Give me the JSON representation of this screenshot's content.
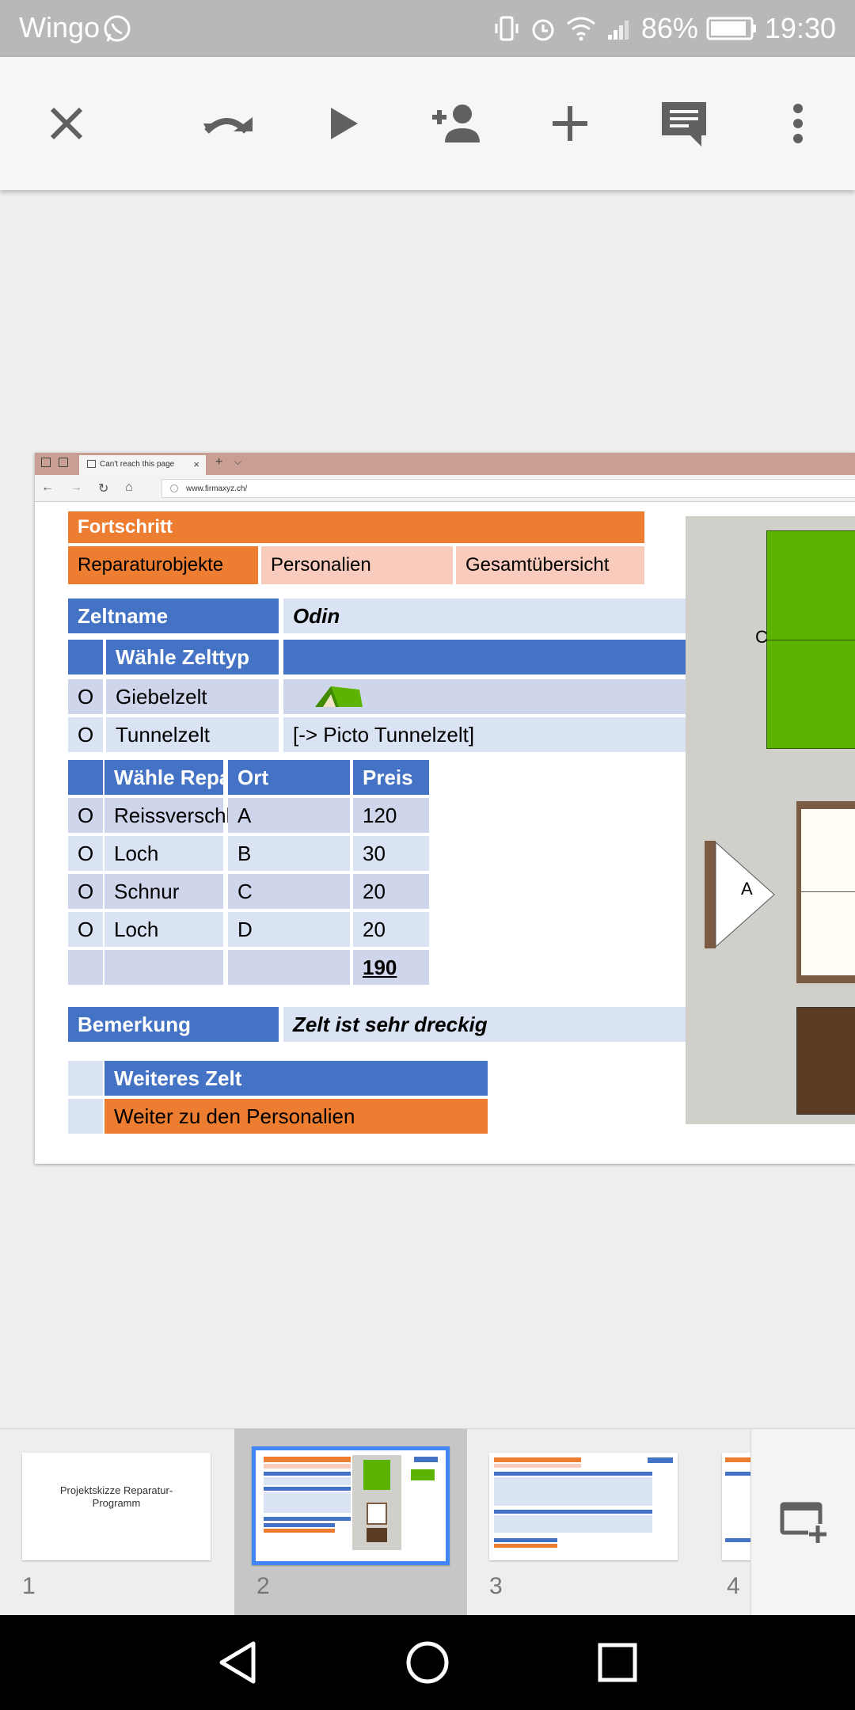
{
  "status_bar": {
    "carrier": "Wingo",
    "battery": "86%",
    "time": "19:30"
  },
  "toolbar": {
    "icons": [
      "close-icon",
      "redo-icon",
      "play-icon",
      "add-person-icon",
      "add-icon",
      "comment-icon",
      "more-vert-icon"
    ]
  },
  "browser": {
    "tab_title": "Can't reach this page",
    "url": "www.firmaxyz.ch/"
  },
  "slide": {
    "progress_header": "Fortschritt",
    "tabs": [
      "Reparaturobjekte",
      "Personalien",
      "Gesamtübersicht"
    ],
    "tent_name_label": "Zeltname",
    "tent_name_value": "Odin",
    "tent_type_header": "Wähle Zelttyp",
    "tent_types": [
      {
        "marker": "O",
        "name": "Giebelzelt",
        "picto": ""
      },
      {
        "marker": "O",
        "name": "Tunnelzelt",
        "picto": "[-> Picto Tunnelzelt]"
      }
    ],
    "repair_headers": [
      "Wähle Reparatur",
      "Ort",
      "Preis"
    ],
    "repairs": [
      {
        "marker": "O",
        "item": "Reissverschluss",
        "location": "A",
        "price": "120"
      },
      {
        "marker": "O",
        "item": "Loch",
        "location": "B",
        "price": "30"
      },
      {
        "marker": "O",
        "item": "Schnur",
        "location": "C",
        "price": "20"
      },
      {
        "marker": "O",
        "item": "Loch",
        "location": "D",
        "price": "20"
      }
    ],
    "total": "190",
    "remark_label": "Bemerkung",
    "remark_value": "Zelt ist sehr dreckig",
    "next_tent": "Weiteres Zelt",
    "continue": "Weiter zu den Personalien",
    "drawing_labels": [
      "C",
      "A"
    ]
  },
  "thumbnails": [
    {
      "number": "1",
      "title": "Projektskizze Reparatur-Programm",
      "selected": false
    },
    {
      "number": "2",
      "title": "",
      "selected": true
    },
    {
      "number": "3",
      "title": "",
      "selected": false
    },
    {
      "number": "4",
      "title": "",
      "selected": false
    }
  ],
  "nav_bar": {
    "icons": [
      "back-icon",
      "home-icon",
      "recents-icon"
    ]
  },
  "colors": {
    "orange": "#ed7d31",
    "blue": "#4472c4",
    "light_blue": "#dae3f3",
    "salmon": "#f8cbbd",
    "tent_green": "#5cb400",
    "selection": "#4285f4"
  }
}
